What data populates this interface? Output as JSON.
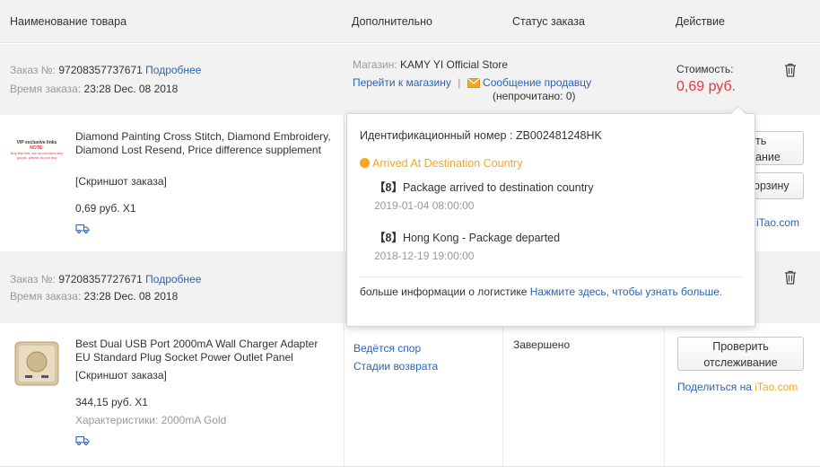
{
  "columns": {
    "product": "Наименование товара",
    "extra": "Дополнительно",
    "status": "Статус заказа",
    "action": "Действие"
  },
  "order1": {
    "num_label": "Заказ №:",
    "num": "97208357737671",
    "details_link": "Подробнее",
    "time_label": "Время заказа:",
    "time": "23:28 Dec. 08 2018",
    "store_label": "Магазин:",
    "store": "KAMY YI Official Store",
    "goto_store": "Перейти к магазину",
    "separator": "|",
    "message_link": "Сообщение продавцу",
    "unread": "(непрочитано: 0)",
    "cost_label": "Стоимость:",
    "cost": "0,69 руб.",
    "item": {
      "thumb_text_1": "VIP exclusive links",
      "thumb_text_2": "NOTE:",
      "thumb_text_3": "Buy this link, we do not send any goods, please do not buy",
      "title": "Diamond Painting Cross Stitch, Diamond Embroidery, Diamond Lost Resend, Price difference supplement",
      "snapshot": "[Скриншот заказа]",
      "price": "0,69 руб. X1",
      "btn1_partial": "ть",
      "btn1b_partial": "ание",
      "btn2_partial": "орзину",
      "share_partial": "iTao.com"
    }
  },
  "order2": {
    "num_label": "Заказ №:",
    "num": "97208357727671",
    "details_link": "Подробнее",
    "time_label": "Время заказа:",
    "time": "23:28 Dec. 08 2018",
    "item": {
      "title": "Best Dual USB Port 2000mA Wall Charger Adapter EU Standard Plug Socket Power Outlet Panel",
      "snapshot": "[Скриншот заказа]",
      "price": "344,15 руб. X1",
      "spec": "Характеристики: 2000mA Gold",
      "dispute": "Ведётся спор",
      "return_stages": "Стадии возврата",
      "status": "Завершено",
      "track_btn_1": "Проверить",
      "track_btn_2": "отслеживание",
      "share_prefix": "Поделиться на ",
      "share_site": "iTao.com"
    }
  },
  "popup": {
    "tracking_label": "Идентификационный номер :",
    "tracking_id": "ZB002481248HK",
    "status": "Arrived At Destination Country",
    "event1_tag": "【8】",
    "event1": "Package arrived to destination country",
    "event1_time": "2019-01-04 08:00:00",
    "event2_tag": "【8】",
    "event2": "Hong Kong - Package departed",
    "event2_time": "2018-12-19 19:00:00",
    "more_text": "больше информации о логистике",
    "more_link": "Нажмите здесь, чтобы узнать больше."
  },
  "colors": {
    "link": "#2a64b3",
    "price_red": "#e4393c",
    "status_orange": "#f5a623"
  }
}
